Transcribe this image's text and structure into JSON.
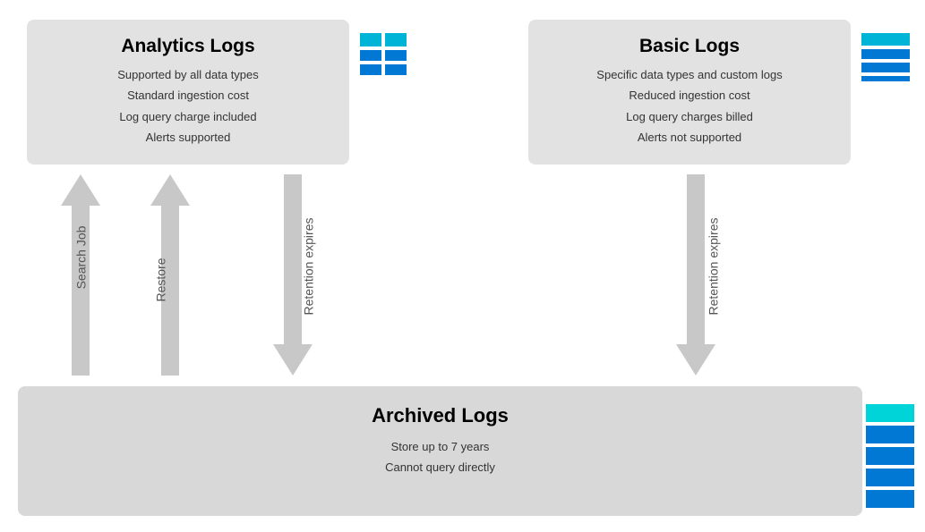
{
  "analytics": {
    "title": "Analytics Logs",
    "features": [
      "Supported by all data types",
      "Standard ingestion cost",
      "Log query charge included",
      "Alerts supported"
    ]
  },
  "basic": {
    "title": "Basic Logs",
    "features": [
      "Specific data types and custom logs",
      "Reduced ingestion cost",
      "Log query charges billed",
      "Alerts not supported"
    ]
  },
  "archived": {
    "title": "Archived Logs",
    "features": [
      "Store up to 7 years",
      "Cannot query directly"
    ]
  },
  "arrows": {
    "search_job": "Search Job",
    "restore": "Restore",
    "retention_expires": "Retention expires"
  },
  "colors": {
    "cyan": "#00b4d8",
    "blue": "#0078d4",
    "arrow_bg": "#d0d0d0",
    "box_bg": "#e0e0e0",
    "archived_bg": "#d4d4d4"
  }
}
